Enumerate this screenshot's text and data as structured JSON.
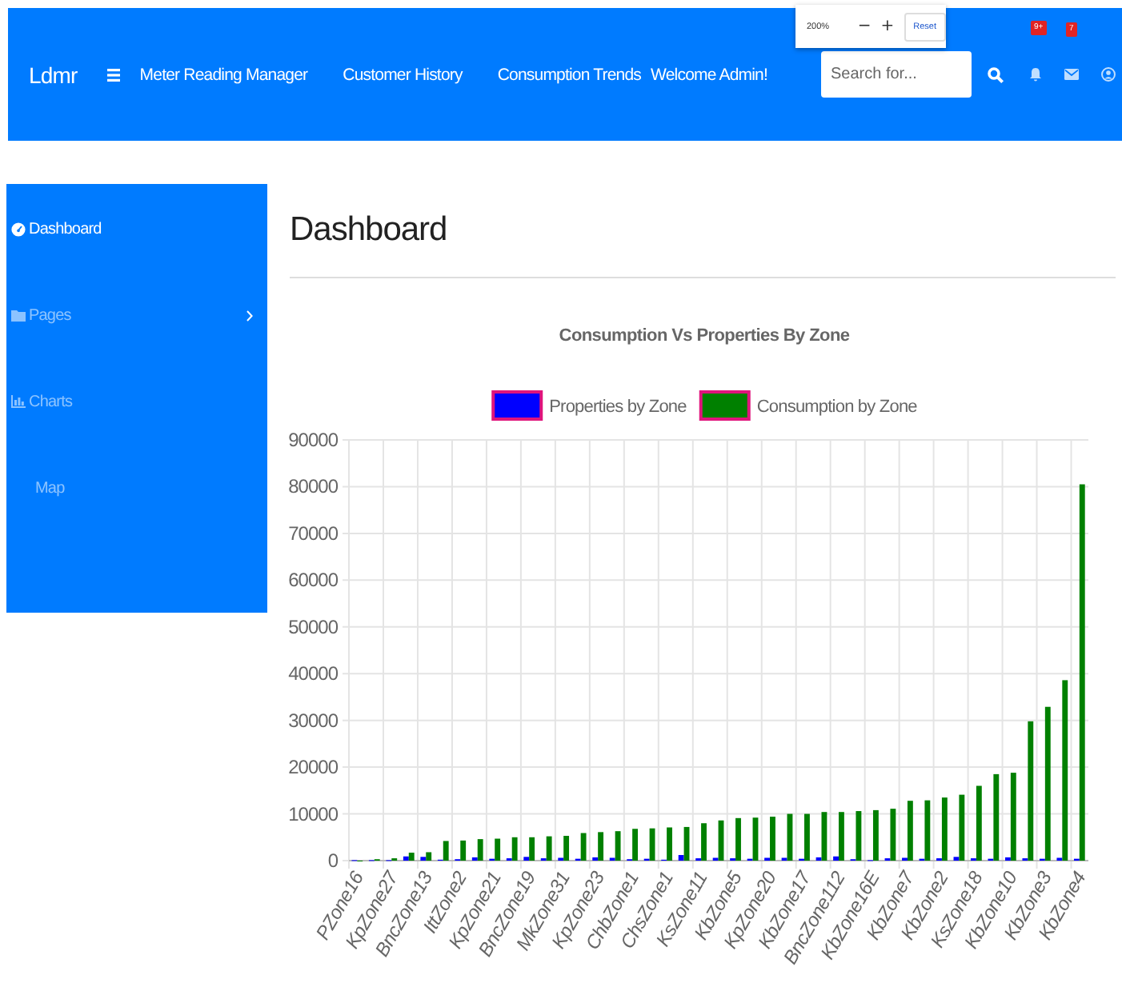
{
  "navbar": {
    "brand": "Ldmr",
    "links": [
      {
        "label": "Meter Reading Manager"
      },
      {
        "label": "Customer History"
      },
      {
        "label": "Consumption Trends"
      },
      {
        "label": "Welcome Admin!"
      }
    ],
    "search": {
      "placeholder": "Search for..."
    },
    "alerts_badge": "9+",
    "messages_badge": "7"
  },
  "zoom_widget": {
    "level": "200%",
    "minus": "−",
    "plus": "+",
    "reset": "Reset"
  },
  "sidebar": {
    "items": [
      {
        "label": "Dashboard",
        "selected": true,
        "submenu": false
      },
      {
        "label": "Pages",
        "selected": false,
        "submenu": true
      },
      {
        "label": "Charts",
        "selected": false,
        "submenu": false
      },
      {
        "label": "Map",
        "selected": false,
        "submenu": false
      }
    ]
  },
  "page": {
    "title": "Dashboard",
    "chart_data": {
      "type": "bar",
      "title": "Consumption Vs Properties By Zone",
      "categories": [
        "PZone16",
        null,
        "KpZone27",
        null,
        "BncZone13",
        null,
        "IttZone2",
        null,
        "KpZone21",
        null,
        "BncZone19",
        null,
        "MkZone31",
        null,
        "KpZone23",
        null,
        "ChbZone1",
        null,
        "ChsZone1",
        null,
        "KsZone11",
        null,
        "KbZone5",
        null,
        "KpZone20",
        null,
        "KbZone17",
        null,
        "BncZone112",
        null,
        "KbZone16E",
        null,
        "KbZone7",
        null,
        "KbZone2",
        null,
        "KsZone18",
        null,
        "KbZone10",
        null,
        "KbZone3",
        null,
        "KbZone4"
      ],
      "legend": "top",
      "grid": true,
      "ylim": [
        0,
        90000
      ],
      "yticks": [
        0,
        10000,
        20000,
        30000,
        40000,
        50000,
        60000,
        70000,
        80000,
        90000
      ],
      "series": [
        {
          "name": "Properties by Zone",
          "color": "#0000ff",
          "values": [
            100,
            100,
            100,
            900,
            800,
            200,
            300,
            700,
            400,
            500,
            800,
            500,
            600,
            400,
            700,
            600,
            300,
            400,
            200,
            1200,
            500,
            600,
            500,
            400,
            600,
            600,
            400,
            700,
            900,
            300,
            100,
            500,
            600,
            400,
            500,
            800,
            500,
            400,
            700,
            500,
            400,
            600,
            400
          ]
        },
        {
          "name": "Consumption by Zone",
          "color": "#008000",
          "values": [
            0,
            300,
            500,
            1700,
            1800,
            4200,
            4300,
            4600,
            4700,
            5000,
            5000,
            5200,
            5300,
            5900,
            6100,
            6300,
            6800,
            6900,
            7100,
            7200,
            8000,
            8600,
            9100,
            9200,
            9400,
            10000,
            10000,
            10400,
            10400,
            10600,
            10800,
            11100,
            12800,
            12900,
            13500,
            14100,
            16000,
            18500,
            18800,
            29800,
            32900,
            38600,
            80500
          ]
        }
      ]
    }
  }
}
